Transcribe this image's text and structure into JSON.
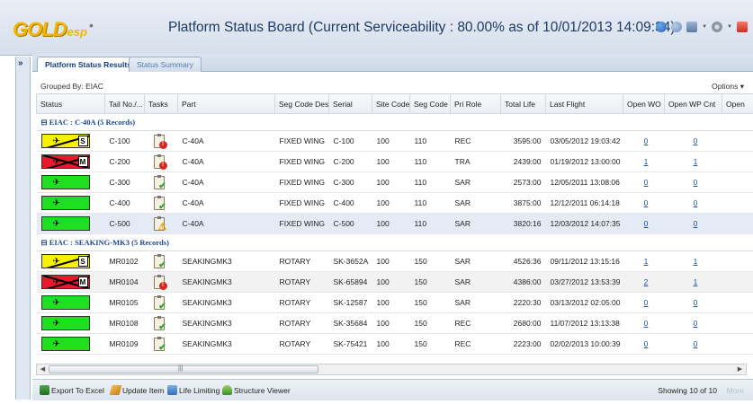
{
  "header": {
    "logo_main": "GOLD",
    "logo_sub": "esp",
    "title": "Platform Status Board (Current Serviceability : 80.00% as of 10/01/2013 14:09:34)"
  },
  "rail": {
    "toggle": "»"
  },
  "tabs": [
    {
      "label": "Platform Status Results",
      "active": true
    },
    {
      "label": "Status Summary",
      "active": false
    }
  ],
  "grid": {
    "grouped_by": "Grouped By:  EIAC",
    "options": "Options ▾",
    "columns": [
      "Status",
      "Tail No./...",
      "Tasks",
      "Part",
      "Seg Code Desc",
      "Serial",
      "Site Code",
      "Seg Code",
      "Pri Role",
      "Total Life",
      "Last Flight",
      "Open WO",
      "Open WP Cnt",
      "Open"
    ],
    "groups": [
      {
        "label": "⊟ EIAC : C-40A (5 Records)",
        "rows": [
          {
            "status": "yellow",
            "status_letter": "S",
            "tail": "C-100",
            "task": "red",
            "part": "C-40A",
            "seg_desc": "FIXED WING",
            "serial": "C-100",
            "site": "100",
            "seg_code": "110",
            "role": "REC",
            "life": "3595:00",
            "last_flight": "03/05/2012 19:03:42",
            "open_wo": "0",
            "open_wp": "0"
          },
          {
            "status": "red",
            "status_letter": "M",
            "tail": "C-200",
            "task": "red",
            "part": "C-40A",
            "seg_desc": "FIXED WING",
            "serial": "C-200",
            "site": "100",
            "seg_code": "110",
            "role": "TRA",
            "life": "2439:00",
            "last_flight": "01/19/2012 13:00:00",
            "open_wo": "1",
            "open_wp": "1"
          },
          {
            "status": "green",
            "status_letter": "",
            "tail": "C-300",
            "task": "check",
            "part": "C-40A",
            "seg_desc": "FIXED WING",
            "serial": "C-300",
            "site": "100",
            "seg_code": "110",
            "role": "SAR",
            "life": "2573:00",
            "last_flight": "12/05/2011 13:08:06",
            "open_wo": "0",
            "open_wp": "0"
          },
          {
            "status": "green",
            "status_letter": "",
            "tail": "C-400",
            "task": "check",
            "part": "C-40A",
            "seg_desc": "FIXED WING",
            "serial": "C-400",
            "site": "100",
            "seg_code": "110",
            "role": "SAR",
            "life": "3875:00",
            "last_flight": "12/12/2011 06:14:18",
            "open_wo": "0",
            "open_wp": "0"
          },
          {
            "status": "green",
            "status_letter": "",
            "tail": "C-500",
            "task": "warn",
            "part": "C-40A",
            "seg_desc": "FIXED WING",
            "serial": "C-500",
            "site": "100",
            "seg_code": "110",
            "role": "SAR",
            "life": "3820:16",
            "last_flight": "12/03/2012 14:07:35",
            "open_wo": "0",
            "open_wp": "0"
          }
        ]
      },
      {
        "label": "⊟ EIAC : SEAKING-MK3 (5 Records)",
        "rows": [
          {
            "status": "yellow",
            "status_letter": "S",
            "tail": "MR0102",
            "task": "check",
            "part": "SEAKINGMK3",
            "seg_desc": "ROTARY",
            "serial": "SK-3652A",
            "site": "100",
            "seg_code": "150",
            "role": "SAR",
            "life": "4526:36",
            "last_flight": "09/11/2012 13:15:16",
            "open_wo": "1",
            "open_wp": "1"
          },
          {
            "status": "red",
            "status_letter": "M",
            "tail": "MR0104",
            "task": "red",
            "part": "SEAKINGMK3",
            "seg_desc": "ROTARY",
            "serial": "SK-65894",
            "site": "100",
            "seg_code": "150",
            "role": "SAR",
            "life": "4386:00",
            "last_flight": "03/27/2012 13:53:39",
            "open_wo": "2",
            "open_wp": "1"
          },
          {
            "status": "green",
            "status_letter": "",
            "tail": "MR0105",
            "task": "check",
            "part": "SEAKINGMK3",
            "seg_desc": "ROTARY",
            "serial": "SK-12587",
            "site": "100",
            "seg_code": "150",
            "role": "SAR",
            "life": "2220:30",
            "last_flight": "03/13/2012 02:05:00",
            "open_wo": "0",
            "open_wp": "0"
          },
          {
            "status": "green",
            "status_letter": "",
            "tail": "MR0108",
            "task": "check",
            "part": "SEAKINGMK3",
            "seg_desc": "ROTARY",
            "serial": "SK-35684",
            "site": "100",
            "seg_code": "150",
            "role": "REC",
            "life": "2680:00",
            "last_flight": "11/07/2012 13:13:38",
            "open_wo": "0",
            "open_wp": "0"
          },
          {
            "status": "green",
            "status_letter": "",
            "tail": "MR0109",
            "task": "check",
            "part": "SEAKINGMK3",
            "seg_desc": "ROTARY",
            "serial": "SK-75421",
            "site": "100",
            "seg_code": "150",
            "role": "REC",
            "life": "2223:00",
            "last_flight": "02/02/2013 10:00:39",
            "open_wo": "0",
            "open_wp": "0"
          }
        ]
      }
    ]
  },
  "footer": {
    "export": "Export To Excel",
    "update": "Update Item",
    "life_limiting": "Life Limiting",
    "structure": "Structure Viewer",
    "showing": "Showing 10 of 10",
    "more": "More"
  }
}
